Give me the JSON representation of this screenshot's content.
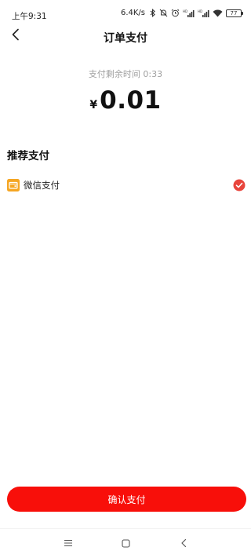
{
  "status_bar": {
    "time": "上午9:31",
    "net_speed": "6.4K/s",
    "battery": "77"
  },
  "header": {
    "title": "订单支付",
    "back_icon": "chevron-left-icon"
  },
  "payment": {
    "timer_text": "支付剩余时间 0:33",
    "currency_symbol": "¥",
    "amount": "0.01"
  },
  "methods_section": {
    "title": "推荐支付",
    "options": [
      {
        "label": "微信支付",
        "icon": "wallet-icon",
        "selected": true
      }
    ]
  },
  "confirm": {
    "label": "确认支付"
  },
  "colors": {
    "accent": "#f80f0a",
    "check": "#e8453c",
    "wallet": "#f5a623",
    "muted_text": "#a0a0a0"
  },
  "nav_bar": {
    "icons": [
      "menu-icon",
      "home-square-icon",
      "back-triangle-icon"
    ]
  }
}
